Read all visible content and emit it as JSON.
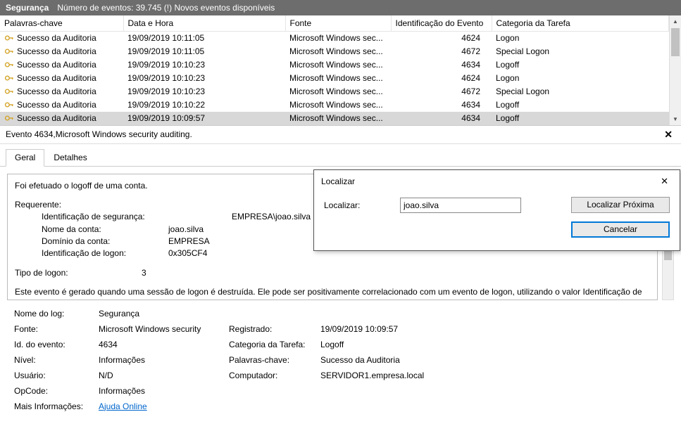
{
  "titlebar": {
    "title": "Segurança",
    "subtitle": "Número de eventos: 39.745 (!) Novos eventos disponíveis"
  },
  "columns": {
    "c0": "Palavras-chave",
    "c1": "Data e Hora",
    "c2": "Fonte",
    "c3": "Identificação do Evento",
    "c4": "Categoria da Tarefa"
  },
  "rows": [
    {
      "kw": "Sucesso da Auditoria",
      "dt": "19/09/2019 10:11:05",
      "src": "Microsoft Windows sec...",
      "id": "4624",
      "cat": "Logon"
    },
    {
      "kw": "Sucesso da Auditoria",
      "dt": "19/09/2019 10:11:05",
      "src": "Microsoft Windows sec...",
      "id": "4672",
      "cat": "Special Logon"
    },
    {
      "kw": "Sucesso da Auditoria",
      "dt": "19/09/2019 10:10:23",
      "src": "Microsoft Windows sec...",
      "id": "4634",
      "cat": "Logoff"
    },
    {
      "kw": "Sucesso da Auditoria",
      "dt": "19/09/2019 10:10:23",
      "src": "Microsoft Windows sec...",
      "id": "4624",
      "cat": "Logon"
    },
    {
      "kw": "Sucesso da Auditoria",
      "dt": "19/09/2019 10:10:23",
      "src": "Microsoft Windows sec...",
      "id": "4672",
      "cat": "Special Logon"
    },
    {
      "kw": "Sucesso da Auditoria",
      "dt": "19/09/2019 10:10:22",
      "src": "Microsoft Windows sec...",
      "id": "4634",
      "cat": "Logoff"
    },
    {
      "kw": "Sucesso da Auditoria",
      "dt": "19/09/2019 10:09:57",
      "src": "Microsoft Windows sec...",
      "id": "4634",
      "cat": "Logoff"
    }
  ],
  "detail": {
    "header": "Evento 4634,Microsoft Windows security auditing."
  },
  "tabs": {
    "general": "Geral",
    "details": "Detalhes"
  },
  "body": {
    "l1": "Foi efetuado o logoff de uma conta.",
    "l2": "Requerente:",
    "f1l": "Identificação de segurança:",
    "f1v": "EMPRESA\\joao.silva",
    "f2l": "Nome da conta:",
    "f2v": "joao.silva",
    "f3l": "Domínio da conta:",
    "f3v": "EMPRESA",
    "f4l": "Identificação de logon:",
    "f4v": "0x305CF4",
    "f5l": "Tipo de logon:",
    "f5v": "3",
    "foot": "Este evento é gerado quando uma sessão de logon é destruída. Ele pode ser positivamente correlacionado com um evento de logon, utilizando o valor Identificação de logon. As identificações de logon são exclusivas apenas entre as reinicializações do mesmo computador."
  },
  "meta": {
    "r1a": "Nome do log:",
    "r1b": "Segurança",
    "r2a": "Fonte:",
    "r2b": "Microsoft Windows security",
    "r2c": "Registrado:",
    "r2d": "19/09/2019 10:09:57",
    "r3a": "Id. do evento:",
    "r3b": "4634",
    "r3c": "Categoria da Tarefa:",
    "r3d": "Logoff",
    "r4a": "Nível:",
    "r4b": "Informações",
    "r4c": "Palavras-chave:",
    "r4d": "Sucesso da Auditoria",
    "r5a": "Usuário:",
    "r5b": "N/D",
    "r5c": "Computador:",
    "r5d": "SERVIDOR1.empresa.local",
    "r6a": "OpCode:",
    "r6b": "Informações",
    "r7a": "Mais Informações:",
    "r7b": "Ajuda Online"
  },
  "dialog": {
    "title": "Localizar",
    "label": "Localizar:",
    "value": "joao.silva",
    "find": "Localizar Próxima",
    "cancel": "Cancelar"
  }
}
